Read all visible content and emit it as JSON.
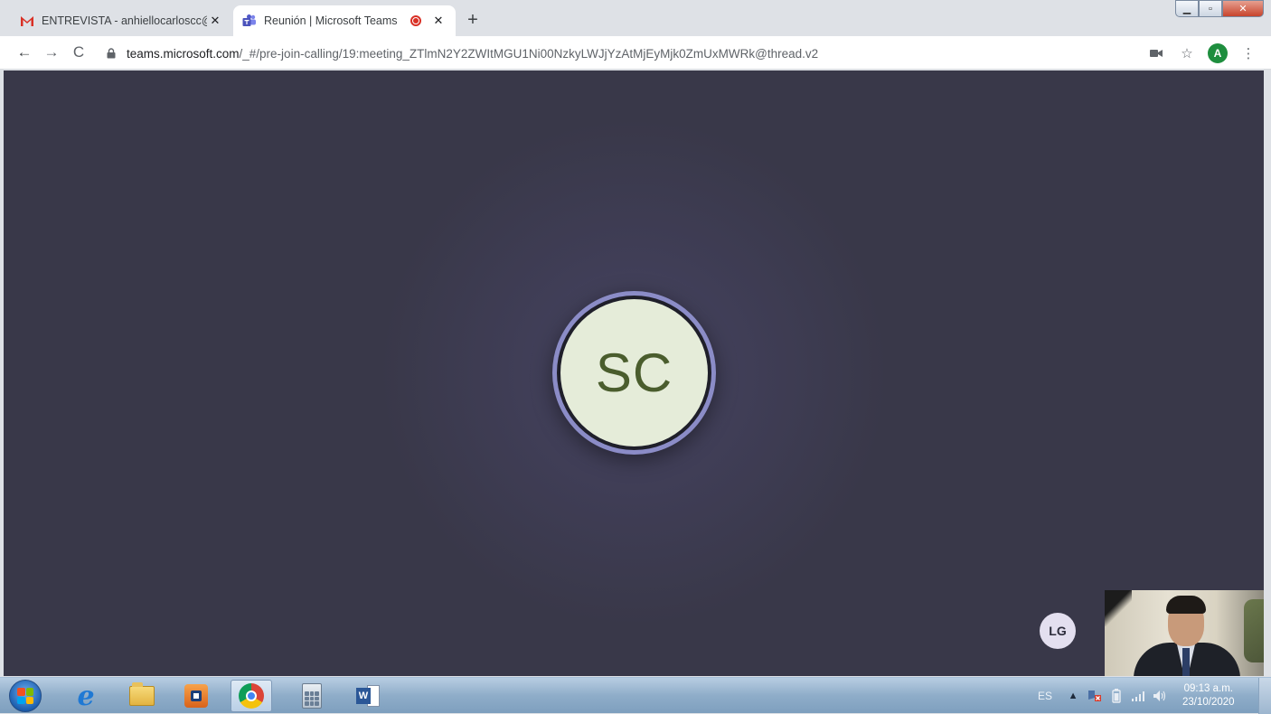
{
  "browser": {
    "tabs": [
      {
        "title": "ENTREVISTA - anhiellocarloscc@",
        "icon": "gmail-icon",
        "active": false
      },
      {
        "title": "Reunión | Microsoft Teams",
        "icon": "teams-icon",
        "active": true
      }
    ],
    "address": {
      "host": "teams.microsoft.com",
      "path": "/_#/pre-join-calling/19:meeting_ZTlmN2Y2ZWItMGU1Ni00NzkyLWJjYzAtMjEyMjk0ZmUxMWRk@thread.v2"
    },
    "profile_initial": "A"
  },
  "meeting": {
    "main_participant_initials": "SC",
    "small_participant_initials": "LG"
  },
  "taskbar": {
    "apps": [
      "internet-explorer",
      "file-explorer",
      "media-center",
      "chrome",
      "calculator",
      "word"
    ],
    "active_app": "chrome",
    "language": "ES",
    "time": "09:13 a.m.",
    "date": "23/10/2020"
  },
  "colors": {
    "stage_background": "#393849",
    "avatar_ring": "#8b8cc7",
    "avatar_fill": "#e5ecd9",
    "avatar_text": "#4a5d2d",
    "recording_dot": "#d93025"
  }
}
